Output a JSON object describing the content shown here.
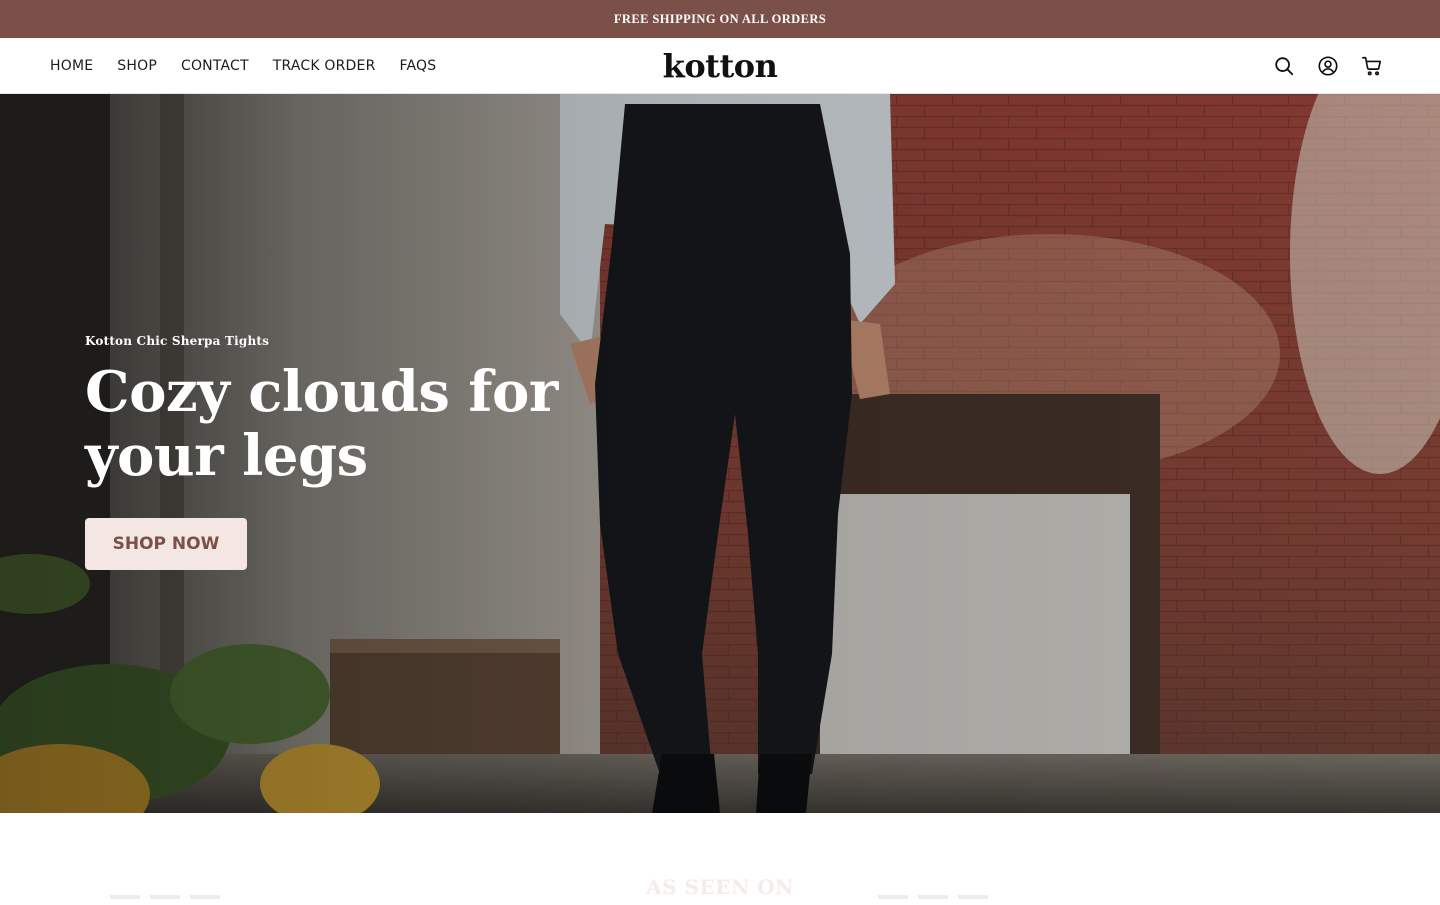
{
  "announcement": {
    "text": "FREE SHIPPING ON ALL ORDERS"
  },
  "header": {
    "nav": [
      "HOME",
      "SHOP",
      "CONTACT",
      "TRACK ORDER",
      "FAQS"
    ],
    "logo": "kotton",
    "icons": [
      "search-icon",
      "account-icon",
      "cart-icon"
    ]
  },
  "hero": {
    "kicker": "Kotton Chic Sherpa Tights",
    "title_line1": "Cozy clouds for",
    "title_line2": "your legs",
    "cta": "SHOP NOW"
  },
  "press": {
    "title": "AS SEEN ON"
  },
  "colors": {
    "announcement_bg": "#7a5048",
    "cta_bg": "#f4e6e3",
    "cta_text": "#7a5048"
  }
}
